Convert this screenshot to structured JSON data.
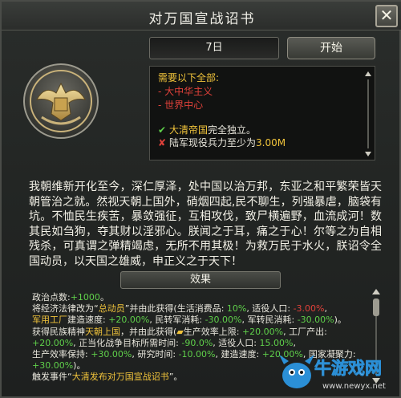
{
  "window": {
    "title": "对万国宣战诏书",
    "close_label": "✕"
  },
  "controls": {
    "date_value": "7日",
    "start_label": "开始"
  },
  "requirements": {
    "title": "需要以下全部:",
    "items": [
      "- 大中华主义",
      "- 世界中心"
    ],
    "cond1_prefix": "",
    "cond1_name": "大清帝国",
    "cond1_suffix": "完全独立。",
    "cond2_prefix": "陆军现役兵力至少为",
    "cond2_value": "3.00M"
  },
  "body": {
    "text": "我朝维新开化至今，深仁厚泽，处中国以治万邦，东亚之和平繁荣皆天朝管治之就。然视天朝上国外，硝烟四起,民不聊生，列强暴虐，脑袋有坑。不恤民生疾苦，暴敛强征，互相攻伐，致尸横遍野，血流成河！数其民如刍狗，夺其财以淫邪心。朕闻之于耳，痛之于心！尔等之为自相残杀，可真谓之弹精竭虑，无所不用其极！为救万民于水火，朕诏令全国动员，以天国之雄威，申正义之于天下！"
  },
  "effects": {
    "header": "效果",
    "l1a": "政治点数:",
    "l1b": "+1000",
    "l1c": "。",
    "l2a": "将经济法律改为“",
    "l2b": "总动员",
    "l2c": "”并由此获得(生活消费品: ",
    "l2d": "10%",
    "l2e": ", 适役人口: ",
    "l2f": "-3.00%",
    "l2g": ",",
    "l3a": "军用工厂",
    "l3b": "建造速度: ",
    "l3c": "+20.00%",
    "l3d": ", 民转军消耗: ",
    "l3e": "-30.00%",
    "l3f": ", 军转民消耗: ",
    "l3g": "-30.00%",
    "l3h": ")。",
    "l4a": "获得民族精神",
    "l4b": "天朝上国",
    "l4c": "，并由此获得(",
    "l4d": "生产效率上限: ",
    "l4e": "+20.00%",
    "l4f": ", 工厂产出:",
    "l5a": "+20.00%",
    "l5b": ", 正当化战争目标所需时间: ",
    "l5c": "-90.0%",
    "l5d": ", 适役人口: ",
    "l5e": "15.00%",
    "l5f": ",",
    "l6a": "生产效率保持: ",
    "l6b": "+30.00%",
    "l6c": ", 研究时间: ",
    "l6d": "-10.00%",
    "l6e": ", 建造速度: ",
    "l6f": "+20.00%",
    "l6g": ", 国家凝聚力:",
    "l7a": "+30.00%",
    "l7b": ")。",
    "l8a": "触发事件“",
    "l8b": "大清发布对万国宣战诏书",
    "l8c": "”。"
  },
  "watermark": {
    "name": "牛游戏网",
    "url": "www.newyx.net"
  },
  "colors": {
    "positive": "#5fd04a",
    "negative": "#e0413a",
    "highlight": "#f0c33b"
  }
}
